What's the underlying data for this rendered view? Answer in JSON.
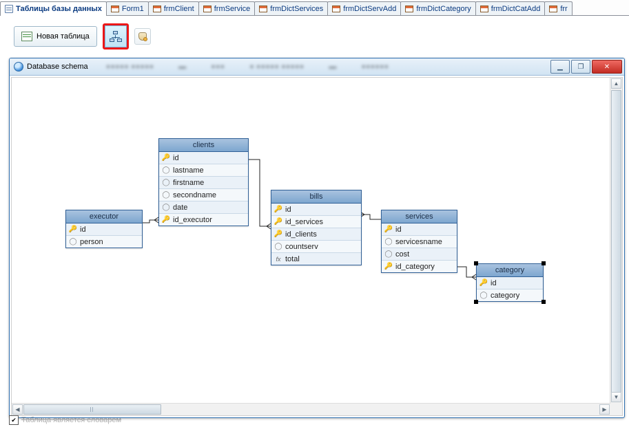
{
  "tabs": {
    "items": [
      {
        "label": "Таблицы базы данных",
        "active": true,
        "icon": "db"
      },
      {
        "label": "Form1",
        "active": false,
        "icon": "form"
      },
      {
        "label": "frmClient",
        "active": false,
        "icon": "form"
      },
      {
        "label": "frmService",
        "active": false,
        "icon": "form"
      },
      {
        "label": "frmDictServices",
        "active": false,
        "icon": "form"
      },
      {
        "label": "frmDictServAdd",
        "active": false,
        "icon": "form"
      },
      {
        "label": "frmDictCategory",
        "active": false,
        "icon": "form"
      },
      {
        "label": "frmDictCatAdd",
        "active": false,
        "icon": "form"
      },
      {
        "label": "frr",
        "active": false,
        "icon": "form"
      }
    ]
  },
  "toolbar": {
    "new_table_label": "Новая таблица"
  },
  "child_window": {
    "title": "Database schema"
  },
  "schema": {
    "tables": {
      "executor": {
        "title": "executor",
        "fields": [
          {
            "name": "id",
            "kind": "pk"
          },
          {
            "name": "person",
            "kind": "col"
          }
        ]
      },
      "clients": {
        "title": "clients",
        "fields": [
          {
            "name": "id",
            "kind": "pk"
          },
          {
            "name": "lastname",
            "kind": "col"
          },
          {
            "name": "firstname",
            "kind": "col"
          },
          {
            "name": "secondname",
            "kind": "col"
          },
          {
            "name": "date",
            "kind": "col"
          },
          {
            "name": "id_executor",
            "kind": "fk"
          }
        ]
      },
      "bills": {
        "title": "bills",
        "fields": [
          {
            "name": "id",
            "kind": "pk"
          },
          {
            "name": "id_services",
            "kind": "fk"
          },
          {
            "name": "id_clients",
            "kind": "fk"
          },
          {
            "name": "countserv",
            "kind": "col"
          },
          {
            "name": "total",
            "kind": "fx"
          }
        ]
      },
      "services": {
        "title": "services",
        "fields": [
          {
            "name": "id",
            "kind": "pk"
          },
          {
            "name": "servicesname",
            "kind": "col"
          },
          {
            "name": "cost",
            "kind": "col"
          },
          {
            "name": "id_category",
            "kind": "fk"
          }
        ]
      },
      "category": {
        "title": "category",
        "fields": [
          {
            "name": "id",
            "kind": "pk"
          },
          {
            "name": "category",
            "kind": "col"
          }
        ]
      }
    }
  },
  "status": {
    "text": "Таблица является словарем"
  }
}
